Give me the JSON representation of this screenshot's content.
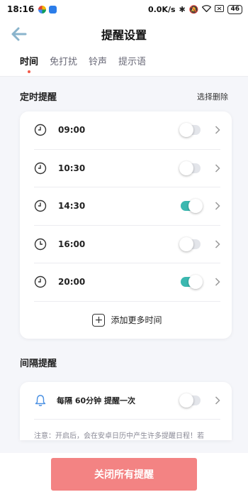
{
  "status_bar": {
    "time": "18:16",
    "network_speed": "0.0K/s",
    "battery": "46"
  },
  "header": {
    "title": "提醒设置"
  },
  "tabs": [
    {
      "label": "时间",
      "active": true
    },
    {
      "label": "免打扰",
      "active": false
    },
    {
      "label": "铃声",
      "active": false
    },
    {
      "label": "提示语",
      "active": false
    }
  ],
  "timed_reminders": {
    "title": "定时提醒",
    "action": "选择删除",
    "items": [
      {
        "time": "09:00",
        "enabled": false
      },
      {
        "time": "10:30",
        "enabled": false
      },
      {
        "time": "14:30",
        "enabled": true
      },
      {
        "time": "16:00",
        "enabled": false
      },
      {
        "time": "20:00",
        "enabled": true
      }
    ],
    "add_more": "添加更多时间"
  },
  "interval_reminder": {
    "title": "间隔提醒",
    "text": "每隔 60分钟 提醒一次",
    "enabled": false,
    "note": "注意：开启后，会在安卓日历中产生许多提醒日程！若"
  },
  "footer": {
    "close_all": "关闭所有提醒"
  },
  "colors": {
    "accent": "#3bb8b0",
    "tab_dot": "#f25a4a",
    "close_button": "#f38383",
    "back_arrow": "#8ab4cc",
    "bell": "#4a90e2"
  }
}
